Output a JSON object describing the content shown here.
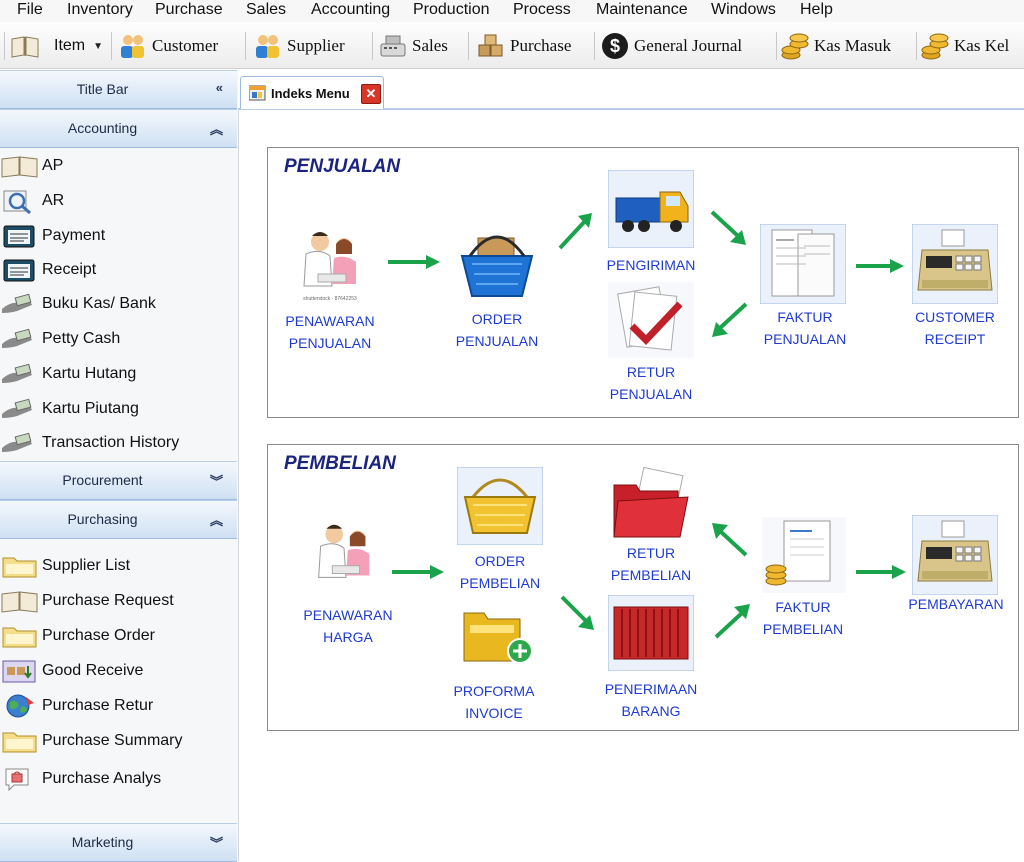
{
  "menubar": [
    "File",
    "Inventory",
    "Purchase",
    "Sales",
    "Accounting",
    "Production",
    "Process",
    "Maintenance",
    "Windows",
    "Help"
  ],
  "toolbar": {
    "item": "Item",
    "customer": "Customer",
    "supplier": "Supplier",
    "sales": "Sales",
    "purchase": "Purchase",
    "general_journal": "General Journal",
    "kas_masuk": "Kas Masuk",
    "kas_keluar": "Kas Kel"
  },
  "sidebar": {
    "title_bar": "Title Bar",
    "accounting": {
      "title": "Accounting",
      "items": [
        "AP",
        "AR",
        "Payment",
        "Receipt",
        "Buku Kas/ Bank",
        "Petty Cash",
        "Kartu Hutang",
        "Kartu Piutang",
        "Transaction History"
      ]
    },
    "procurement": "Procurement",
    "purchasing": {
      "title": "Purchasing",
      "items": [
        "Supplier List",
        "Purchase Request",
        "Purchase Order",
        "Good Receive",
        "Purchase Retur",
        "Purchase Summary",
        "Purchase Analys"
      ]
    },
    "marketing": "Marketing"
  },
  "tab": {
    "label": "Indeks Menu"
  },
  "penjualan": {
    "title": "PENJUALAN",
    "penawaran": [
      "PENAWARAN",
      "PENJUALAN"
    ],
    "order": [
      "ORDER",
      "PENJUALAN"
    ],
    "pengiriman": [
      "PENGIRIMAN"
    ],
    "retur": [
      "RETUR",
      "PENJUALAN"
    ],
    "faktur": [
      "FAKTUR",
      "PENJUALAN"
    ],
    "customer_receipt": [
      "CUSTOMER",
      "RECEIPT"
    ],
    "photo_caption": "shutterstock · 87642253"
  },
  "pembelian": {
    "title": "PEMBELIAN",
    "penawaran": [
      "PENAWARAN",
      "HARGA"
    ],
    "order": [
      "ORDER",
      "PEMBELIAN"
    ],
    "proforma": [
      "PROFORMA",
      "INVOICE"
    ],
    "retur": [
      "RETUR",
      "PEMBELIAN"
    ],
    "penerimaan": [
      "PENERIMAAN",
      "BARANG"
    ],
    "faktur": [
      "FAKTUR",
      "PEMBELIAN"
    ],
    "pembayaran": [
      "PEMBAYARAN"
    ]
  },
  "colors": {
    "accent_blue": "#1f3ad1",
    "title_navy": "#1a237e",
    "arrow_green": "#1aa34a"
  }
}
